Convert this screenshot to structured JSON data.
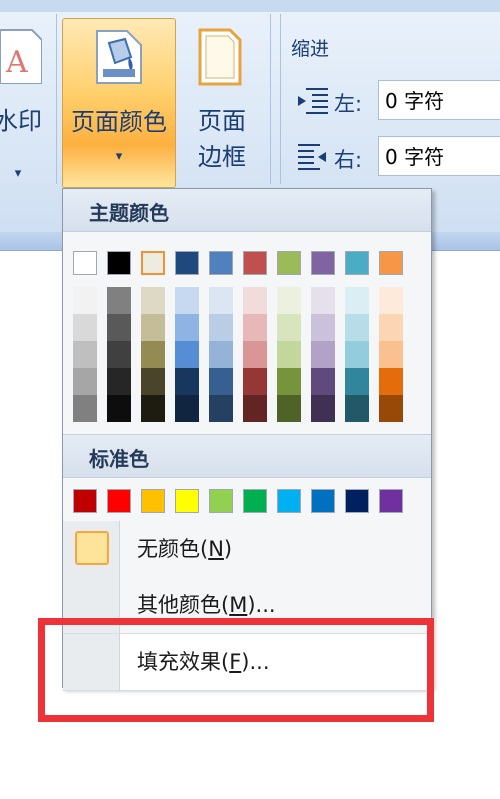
{
  "ribbon": {
    "watermark": {
      "label": "水印",
      "arrow": "▾"
    },
    "page_color": {
      "label": "页面颜色",
      "arrow": "▾"
    },
    "page_border": {
      "label_line1": "页面",
      "label_line2": "边框"
    },
    "indent": {
      "title": "缩进",
      "left": {
        "label": "左:",
        "value": "0 字符"
      },
      "right": {
        "label": "右:",
        "value": "0 字符"
      }
    }
  },
  "menu": {
    "theme_colors_header": "主题颜色",
    "standard_colors_header": "标准色",
    "theme_top_row": [
      "#ffffff",
      "#000000",
      "#eeece1",
      "#1f497d",
      "#4f81bd",
      "#c0504d",
      "#9bbb59",
      "#8064a2",
      "#4bacc6",
      "#f79646"
    ],
    "theme_shades": [
      [
        "#f2f2f2",
        "#d9d9d9",
        "#bfbfbf",
        "#a6a6a6",
        "#808080"
      ],
      [
        "#808080",
        "#595959",
        "#404040",
        "#262626",
        "#0d0d0d"
      ],
      [
        "#ddd9c4",
        "#c4bd97",
        "#948b54",
        "#4a452a",
        "#1e1c11"
      ],
      [
        "#c6d9f1",
        "#8eb4e3",
        "#558ed5",
        "#17375e",
        "#10253f"
      ],
      [
        "#dce6f2",
        "#b9cde5",
        "#95b3d7",
        "#376092",
        "#254061"
      ],
      [
        "#f2dcdb",
        "#e6b9b8",
        "#d99694",
        "#953735",
        "#632523"
      ],
      [
        "#ebf1de",
        "#d7e4bd",
        "#c3d69b",
        "#77933c",
        "#4f6228"
      ],
      [
        "#e6e0ec",
        "#ccc1da",
        "#b3a2c7",
        "#604a7b",
        "#403152"
      ],
      [
        "#dbeef4",
        "#b7dee8",
        "#93cddd",
        "#31859c",
        "#215968"
      ],
      [
        "#fdeada",
        "#fcd5b5",
        "#fac090",
        "#e46c0a",
        "#984807"
      ]
    ],
    "standard_colors": [
      "#c00000",
      "#ff0000",
      "#ffc000",
      "#ffff00",
      "#92d050",
      "#00b050",
      "#00b0f0",
      "#0070c0",
      "#002060",
      "#7030a0"
    ],
    "items": {
      "no_color": {
        "prefix": "无颜色(",
        "key": "N",
        "suffix": ")"
      },
      "more_colors": {
        "prefix": "其他颜色(",
        "key": "M",
        "suffix": ")..."
      },
      "fill_effects": {
        "prefix": "填充效果(",
        "key": "F",
        "suffix": ")..."
      }
    }
  },
  "annotation": {
    "highlight_color": "#ee3338"
  }
}
